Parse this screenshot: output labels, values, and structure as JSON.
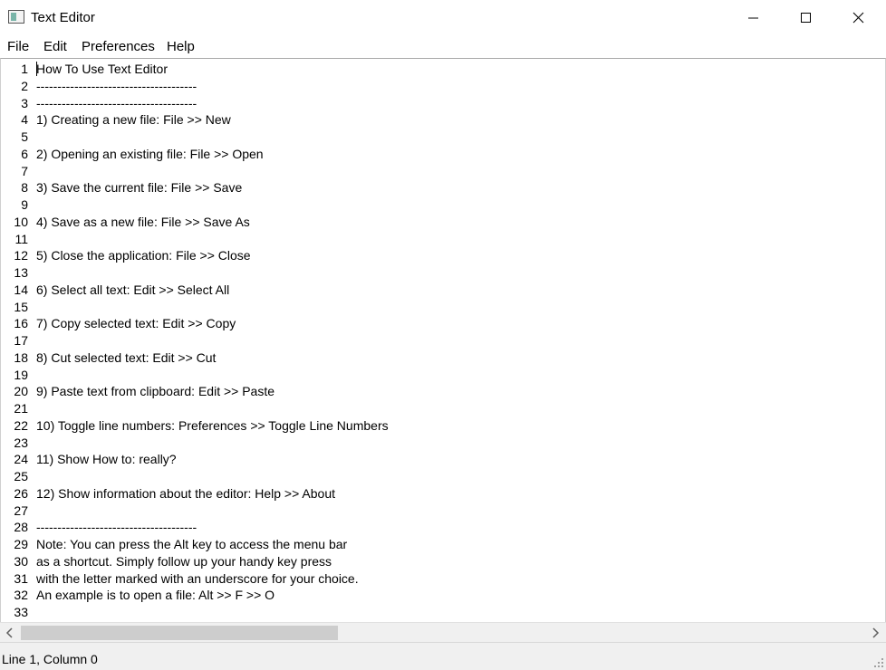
{
  "window": {
    "title": "Text Editor"
  },
  "menu": {
    "file": "File",
    "edit": "Edit",
    "preferences": "Preferences",
    "help": "Help"
  },
  "editor": {
    "line_numbers": [
      "1",
      "2",
      "3",
      "4",
      "5",
      "6",
      "7",
      "8",
      "9",
      "10",
      "11",
      "12",
      "13",
      "14",
      "15",
      "16",
      "17",
      "18",
      "19",
      "20",
      "21",
      "22",
      "23",
      "24",
      "25",
      "26",
      "27",
      "28",
      "29",
      "30",
      "31",
      "32",
      "33"
    ],
    "lines": [
      "How To Use Text Editor",
      "--------------------------------------",
      "--------------------------------------",
      "1) Creating a new file: File >> New",
      "",
      "2) Opening an existing file: File >> Open",
      "",
      "3) Save the current file: File >> Save",
      "",
      "4) Save as a new file: File >> Save As",
      "",
      "5) Close the application: File >> Close",
      "",
      "6) Select all text: Edit >> Select All",
      "",
      "7) Copy selected text: Edit >> Copy",
      "",
      "8) Cut selected text: Edit >> Cut",
      "",
      "9) Paste text from clipboard: Edit >> Paste",
      "",
      "10) Toggle line numbers: Preferences >> Toggle Line Numbers",
      "",
      "11) Show How to: really?",
      "",
      "12) Show information about the editor: Help >> About",
      "",
      "--------------------------------------",
      "Note: You can press the Alt key to access the menu bar",
      "as a shortcut. Simply follow up your handy key press",
      "with the letter marked with an underscore for your choice.",
      "An example is to open a file: Alt >> F >> O",
      ""
    ]
  },
  "status": {
    "text": "Line 1, Column 0"
  }
}
